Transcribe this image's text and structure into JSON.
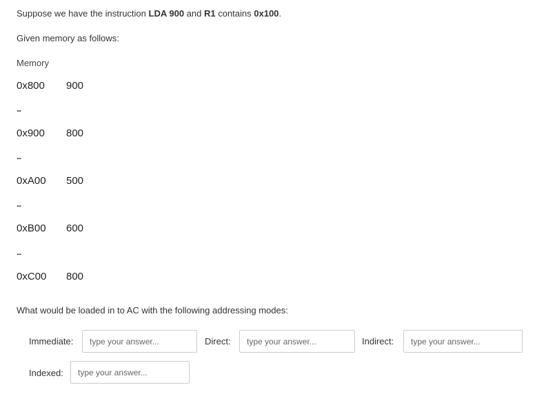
{
  "question": {
    "intro": {
      "prefix": "Suppose we have the instruction ",
      "instruction": "LDA 900",
      "middle": " and ",
      "register": "R1",
      "contains": " contains ",
      "register_value": "0x100",
      "suffix": "."
    },
    "given": "Given memory as follows:",
    "memory_title": "Memory",
    "memory": [
      {
        "address": "0x800",
        "value": "900"
      },
      {
        "address": "0x900",
        "value": "800"
      },
      {
        "address": "0xA00",
        "value": "500"
      },
      {
        "address": "0xB00",
        "value": "600"
      },
      {
        "address": "0xC00",
        "value": "800"
      }
    ],
    "ellipsis": "...",
    "prompt": "What would be loaded in to AC with the following addressing modes:"
  },
  "answers": {
    "immediate": {
      "label": "Immediate:",
      "placeholder": "type your answer...",
      "value": ""
    },
    "direct": {
      "label": "Direct:",
      "placeholder": "type your answer...",
      "value": ""
    },
    "indirect": {
      "label": "Indirect:",
      "placeholder": "type your answer...",
      "value": ""
    },
    "indexed": {
      "label": "Indexed:",
      "placeholder": "type your answer...",
      "value": ""
    }
  }
}
